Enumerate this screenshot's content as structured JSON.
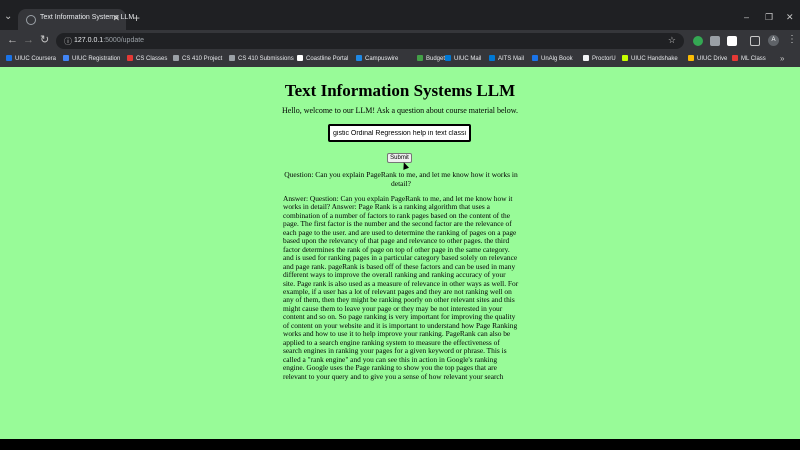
{
  "browser": {
    "tab_title": "Text Information Systems LLM",
    "url_host": "127.0.0.1",
    "url_path": ":5000/update",
    "avatar_letter": "A",
    "bookmarks": [
      {
        "label": "UIUC Coursera",
        "color": "#1a73e8"
      },
      {
        "label": "UIUC Registration",
        "color": "#4285f4"
      },
      {
        "label": "CS Classes",
        "color": "#e53935"
      },
      {
        "label": "CS 410 Project",
        "color": "#9aa0a6"
      },
      {
        "label": "CS 410 Submissions",
        "color": "#9aa0a6"
      },
      {
        "label": "Coastline Portal",
        "color": "#ffffff"
      },
      {
        "label": "Campuswire",
        "color": "#1e88e5"
      },
      {
        "label": "Budget",
        "color": "#43a047"
      },
      {
        "label": "UIUC Mail",
        "color": "#0078d4"
      },
      {
        "label": "AITS Mail",
        "color": "#0078d4"
      },
      {
        "label": "UnAlg Book",
        "color": "#1a73e8"
      },
      {
        "label": "ProctorU",
        "color": "#f1f3f4"
      },
      {
        "label": "UIUC Handshake",
        "color": "#c6ff00"
      },
      {
        "label": "UIUC Drive",
        "color": "#fbbc04"
      },
      {
        "label": "ML Class",
        "color": "#e53935"
      }
    ]
  },
  "page": {
    "title": "Text Information Systems LLM",
    "welcome": "Hello, welcome to our LLM! Ask a question about course material below.",
    "input_value": "gistic Ordinal Regression help in text classification?",
    "submit_label": "Submit",
    "question": "Question: Can you explain PageRank to me, and let me know how it works in detail?",
    "answer": "Answer: Question: Can you explain PageRank to me, and let me know how it works in detail? Answer: Page Rank is a ranking algorithm that uses a combination of a number of factors to rank pages based on the content of the page. The first factor is the number and the second factor are the relevance of each page to the user. and are used to determine the ranking of pages on a page based upon the relevancy of that page and relevance to other pages. the third factor determines the rank of page on top of other page in the same category. and is used for ranking pages in a particular category based solely on relevance and page rank. pageRank is based off of these factors and can be used in many different ways to improve the overall ranking and ranking accuracy of your site. Page rank is also used as a measure of relevance in other ways as well. For example, if a user has a lot of relevant pages and they are not ranking well on any of them, then they might be ranking poorly on other relevant sites and this might cause them to leave your page or they may be not interested in your content and so on. So page ranking is very important for improving the quality of content on your website and it is important to understand how Page Ranking works and how to use it to help improve your ranking. PageRank can also be applied to a search engine ranking system to measure the effectiveness of search engines in ranking your pages for a given keyword or phrase. This is called a \"rank engine\" and you can see this in action in Google's ranking engine. Google uses the Page ranking to show you the top pages that are relevant to your query and to give you a sense of how relevant your search"
  }
}
